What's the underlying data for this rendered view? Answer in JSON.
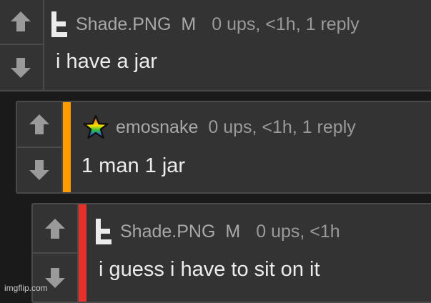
{
  "colors": {
    "background": "#1a1a1a",
    "card": "#333333",
    "stripe_orange": "#ff9c00",
    "stripe_red": "#e8302a"
  },
  "comments": [
    {
      "username": "Shade.PNG",
      "badge": "M",
      "meta": "0 ups, <1h, 1 reply",
      "text": "i have a jar",
      "avatar_icon": "t-logo-icon"
    },
    {
      "username": "emosnake",
      "meta": "0 ups, <1h, 1 reply",
      "text": "1 man 1 jar",
      "avatar_icon": "rainbow-star-icon"
    },
    {
      "username": "Shade.PNG",
      "badge": "M",
      "meta": "0 ups, <1h",
      "text": "i guess i have to sit on it",
      "avatar_icon": "t-logo-icon"
    }
  ],
  "watermark": "imgflip.com"
}
